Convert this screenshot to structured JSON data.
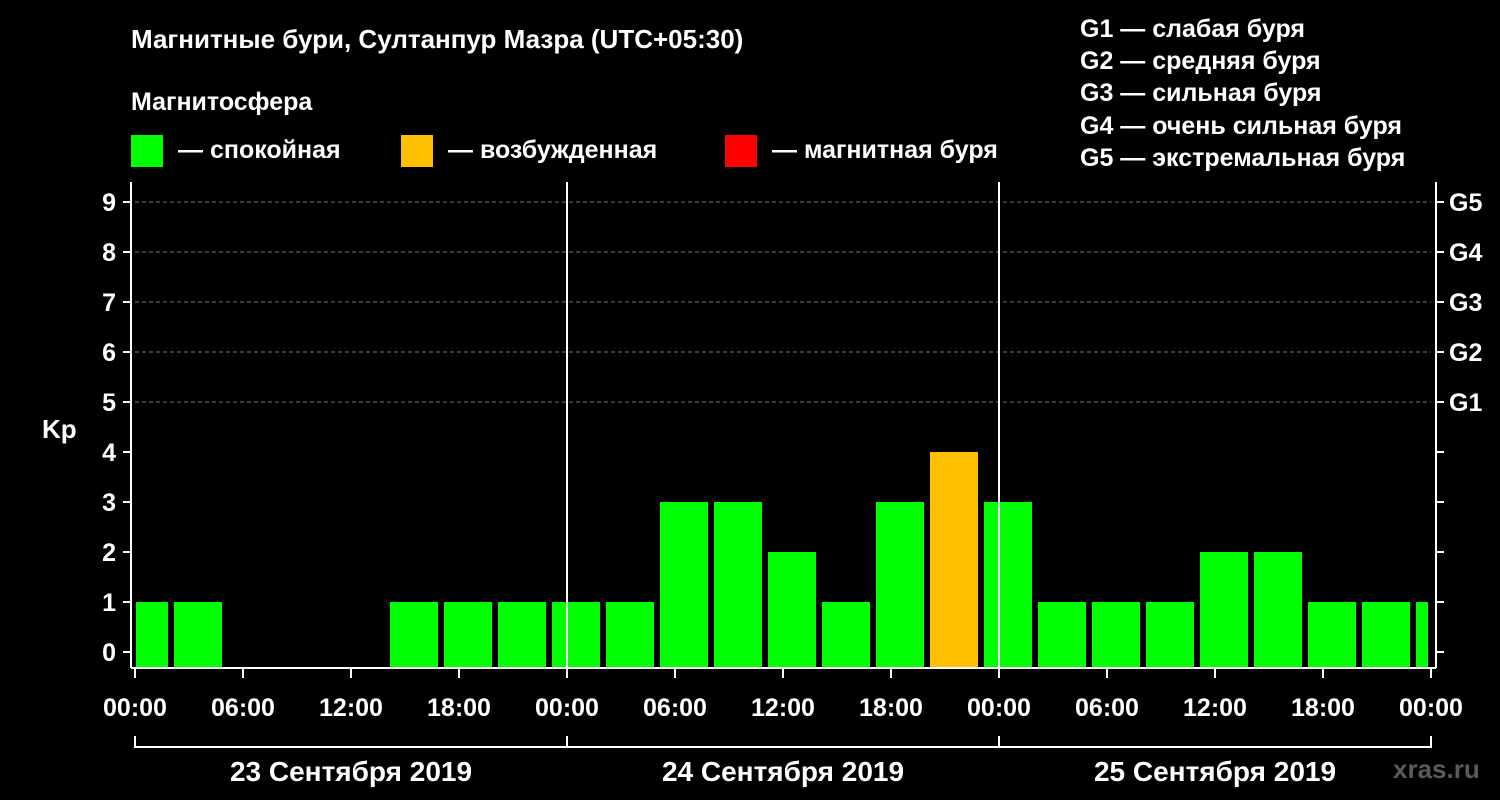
{
  "title": "Магнитные бури, Султанпур Мазра (UTC+05:30)",
  "subtitle": "Магнитосфера",
  "legend": [
    {
      "color": "#00ff00",
      "label": "— спокойная"
    },
    {
      "color": "#ffc000",
      "label": "— возбужденная"
    },
    {
      "color": "#ff0000",
      "label": "— магнитная буря"
    }
  ],
  "storm_levels": [
    "G1 — слабая буря",
    "G2 — средняя буря",
    "G3 — сильная буря",
    "G4 — очень сильная буря",
    "G5 — экстремальная буря"
  ],
  "watermark": "xras.ru",
  "colors": {
    "quiet": "#00ff00",
    "active": "#ffc000",
    "storm": "#ff0000"
  },
  "chart_data": {
    "type": "bar",
    "ylabel": "Kp",
    "ylim": [
      0,
      9
    ],
    "yticks": [
      "0",
      "1",
      "2",
      "3",
      "4",
      "5",
      "6",
      "7",
      "8",
      "9"
    ],
    "right_ticks": [
      {
        "value": 5,
        "label": "G1"
      },
      {
        "value": 6,
        "label": "G2"
      },
      {
        "value": 7,
        "label": "G3"
      },
      {
        "value": 8,
        "label": "G4"
      },
      {
        "value": 9,
        "label": "G5"
      }
    ],
    "grid": true,
    "xlim_hours": [
      0,
      72
    ],
    "xtick_labels": [
      "00:00",
      "06:00",
      "12:00",
      "18:00",
      "00:00",
      "06:00",
      "12:00",
      "18:00",
      "00:00",
      "06:00",
      "12:00",
      "18:00",
      "00:00"
    ],
    "days": [
      "23 Сентября 2019",
      "24 Сентября 2019",
      "25 Сентября 2019"
    ],
    "bars": [
      {
        "start": 0,
        "end": 2,
        "kp": 1,
        "level": "quiet"
      },
      {
        "start": 2,
        "end": 5,
        "kp": 1,
        "level": "quiet"
      },
      {
        "start": 5,
        "end": 8,
        "kp": 0,
        "level": "quiet"
      },
      {
        "start": 8,
        "end": 11,
        "kp": 0,
        "level": "quiet"
      },
      {
        "start": 11,
        "end": 14,
        "kp": 0,
        "level": "quiet"
      },
      {
        "start": 14,
        "end": 17,
        "kp": 1,
        "level": "quiet"
      },
      {
        "start": 17,
        "end": 20,
        "kp": 1,
        "level": "quiet"
      },
      {
        "start": 20,
        "end": 23,
        "kp": 1,
        "level": "quiet"
      },
      {
        "start": 23,
        "end": 26,
        "kp": 1,
        "level": "quiet"
      },
      {
        "start": 26,
        "end": 29,
        "kp": 1,
        "level": "quiet"
      },
      {
        "start": 29,
        "end": 32,
        "kp": 3,
        "level": "quiet"
      },
      {
        "start": 32,
        "end": 35,
        "kp": 3,
        "level": "quiet"
      },
      {
        "start": 35,
        "end": 38,
        "kp": 2,
        "level": "quiet"
      },
      {
        "start": 38,
        "end": 41,
        "kp": 1,
        "level": "quiet"
      },
      {
        "start": 41,
        "end": 44,
        "kp": 3,
        "level": "quiet"
      },
      {
        "start": 44,
        "end": 47,
        "kp": 4,
        "level": "active"
      },
      {
        "start": 47,
        "end": 50,
        "kp": 3,
        "level": "quiet"
      },
      {
        "start": 50,
        "end": 53,
        "kp": 1,
        "level": "quiet"
      },
      {
        "start": 53,
        "end": 56,
        "kp": 1,
        "level": "quiet"
      },
      {
        "start": 56,
        "end": 59,
        "kp": 1,
        "level": "quiet"
      },
      {
        "start": 59,
        "end": 62,
        "kp": 2,
        "level": "quiet"
      },
      {
        "start": 62,
        "end": 65,
        "kp": 2,
        "level": "quiet"
      },
      {
        "start": 65,
        "end": 68,
        "kp": 1,
        "level": "quiet"
      },
      {
        "start": 68,
        "end": 71,
        "kp": 1,
        "level": "quiet"
      },
      {
        "start": 71,
        "end": 72,
        "kp": 1,
        "level": "quiet"
      }
    ]
  }
}
